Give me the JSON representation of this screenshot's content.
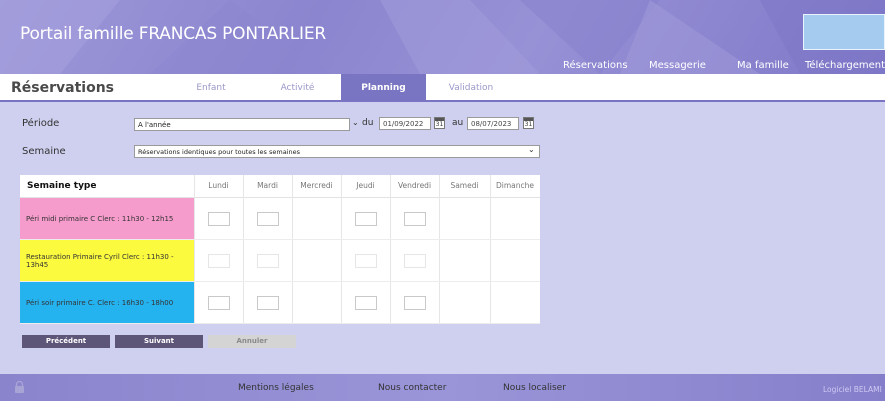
{
  "header": {
    "brand_prefix": "Portail famille",
    "brand_org": "FRANCAS PONTARLIER",
    "nav": [
      "Réservations",
      "Messagerie",
      "Ma famille",
      "Téléchargements"
    ]
  },
  "tabs": {
    "title": "Réservations",
    "items": [
      "Enfant",
      "Activité",
      "Planning",
      "Validation"
    ],
    "active": "Planning"
  },
  "form": {
    "periode_label": "Période",
    "periode_value": "A l'année",
    "du_label": "du",
    "date_from": "01/09/2022",
    "au_label": "au",
    "date_to": "08/07/2023",
    "cal_text": "31",
    "semaine_label": "Semaine",
    "semaine_value": "Réservations identiques pour toutes les semaines"
  },
  "table": {
    "header_first": "Semaine type",
    "days": [
      "Lundi",
      "Mardi",
      "Mercredi",
      "Jeudi",
      "Vendredi",
      "Samedi",
      "Dimanche"
    ],
    "rows": [
      {
        "label": "Péri midi primaire C Clerc : 11h30 - 12h15",
        "color": "#f59ccc"
      },
      {
        "label": "Restauration Primaire Cyril Clerc : 11h30 - 13h45",
        "color": "#fbfa3e"
      },
      {
        "label": "Péri soir primaire C. Clerc : 16h30 - 18h00",
        "color": "#25b3f0"
      }
    ]
  },
  "buttons": {
    "previous": "Précédent",
    "next": "Suivant",
    "cancel": "Annuler"
  },
  "footer": {
    "links": [
      "Mentions légales",
      "Nous contacter",
      "Nous localiser"
    ],
    "credit": "Logiciel BELAMI"
  },
  "colors": {
    "accent": "#7a75c2",
    "button_dark": "#5e5679",
    "button_light": "#d4d4d4"
  }
}
